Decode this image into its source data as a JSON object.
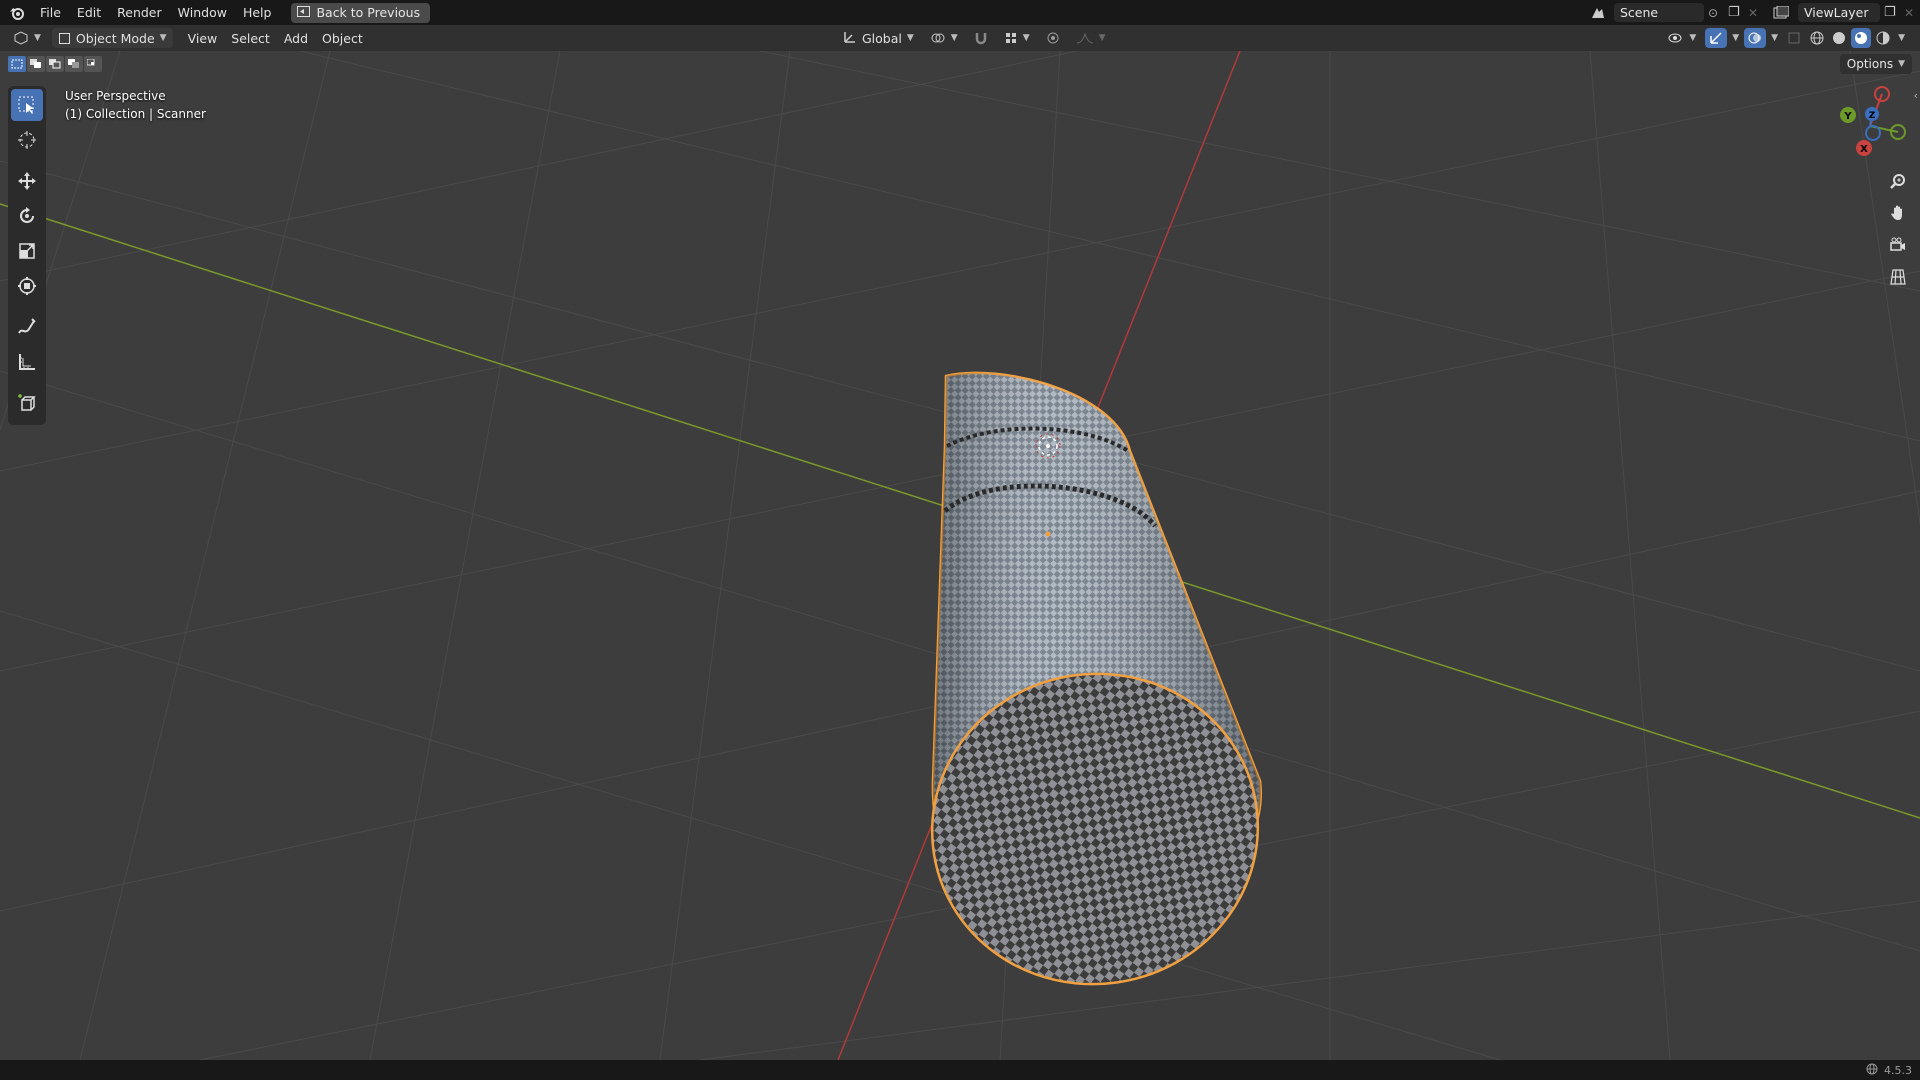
{
  "topbar": {
    "menus": [
      "File",
      "Edit",
      "Render",
      "Window",
      "Help"
    ],
    "back_label": "Back to Previous",
    "scene_name": "Scene",
    "view_layer": "ViewLayer"
  },
  "header": {
    "mode": "Object Mode",
    "menus": [
      "View",
      "Select",
      "Add",
      "Object"
    ],
    "orientation": "Global"
  },
  "viewport": {
    "perspective_label": "User Perspective",
    "object_label": "(1) Collection | Scanner",
    "options_label": "Options",
    "gizmo": {
      "x": "X",
      "y": "Y",
      "z": "Z"
    }
  },
  "tools": [
    "select-box-icon",
    "cursor-icon",
    "move-icon",
    "rotate-icon",
    "scale-icon",
    "transform-icon",
    "annotate-icon",
    "measure-icon",
    "add-cube-icon"
  ],
  "status": {
    "version": "4.5.3"
  },
  "colors": {
    "accent": "#4772b3",
    "selection_outline": "#f0a040",
    "x_axis": "#c8423f",
    "y_axis": "#7ea52a"
  }
}
